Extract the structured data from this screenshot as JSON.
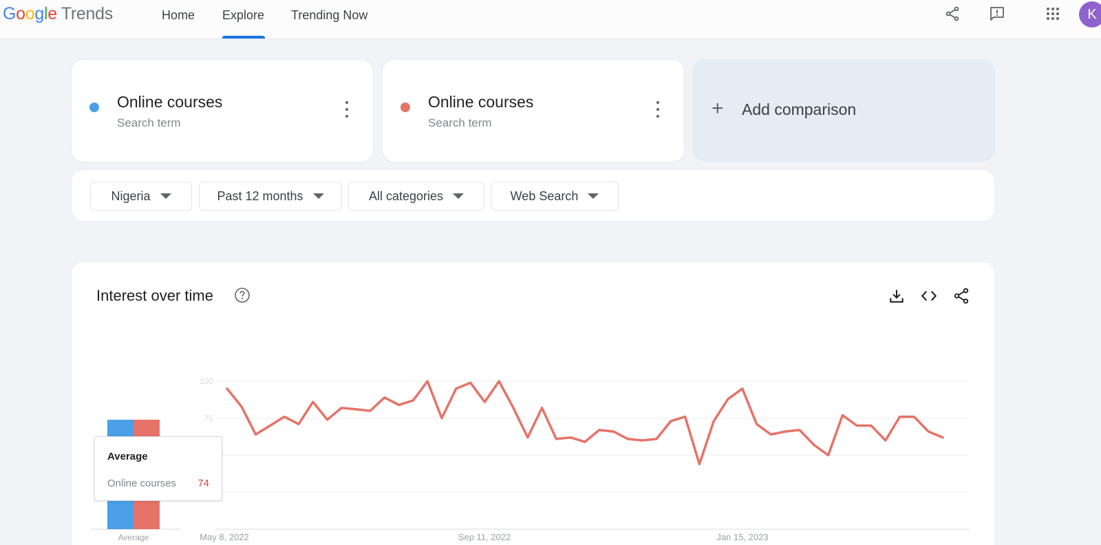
{
  "header": {
    "logo_google": [
      "G",
      "o",
      "o",
      "g",
      "l",
      "e"
    ],
    "logo_trends": "Trends",
    "nav": [
      "Home",
      "Explore",
      "Trending Now"
    ],
    "avatar_letter": "K",
    "icons": [
      "share-icon",
      "feedback-icon",
      "apps-grid-icon"
    ]
  },
  "terms": [
    {
      "name": "Online courses",
      "sub": "Search term",
      "color": "#4a9fe6"
    },
    {
      "name": "Online courses",
      "sub": "Search term",
      "color": "#e57368"
    }
  ],
  "add_comparison": {
    "plus": "+",
    "label": "Add comparison"
  },
  "filters": [
    "Nigeria",
    "Past 12 months",
    "All categories",
    "Web Search"
  ],
  "panel": {
    "title": "Interest over time",
    "icons": [
      "help-icon",
      "download-icon",
      "embed-code-icon",
      "share-icon"
    ]
  },
  "tooltip": {
    "title": "Average",
    "term": "Online courses",
    "value": "74"
  },
  "chart_data": {
    "type": "line",
    "x_tick_labels": [
      "May 8, 2022",
      "Sep 11, 2022",
      "Jan 15, 2023"
    ],
    "y_tick_labels": [
      "100",
      "75"
    ],
    "ylim": [
      0,
      100
    ],
    "average_label": "Average",
    "average_bars": [
      {
        "color": "#4a9fe6",
        "value": 74
      },
      {
        "color": "#e57368",
        "value": 74
      }
    ],
    "series": [
      {
        "color": "#e57368",
        "values": [
          95,
          83,
          64,
          70,
          76,
          71,
          86,
          74,
          82,
          81,
          80,
          89,
          84,
          87,
          100,
          75,
          95,
          99,
          86,
          100,
          82,
          62,
          82,
          61,
          62,
          59,
          67,
          66,
          61,
          60,
          61,
          73,
          76,
          44,
          73,
          88,
          95,
          71,
          64,
          66,
          67,
          57,
          50,
          77,
          70,
          70,
          60,
          76,
          76,
          66,
          62
        ]
      }
    ]
  }
}
